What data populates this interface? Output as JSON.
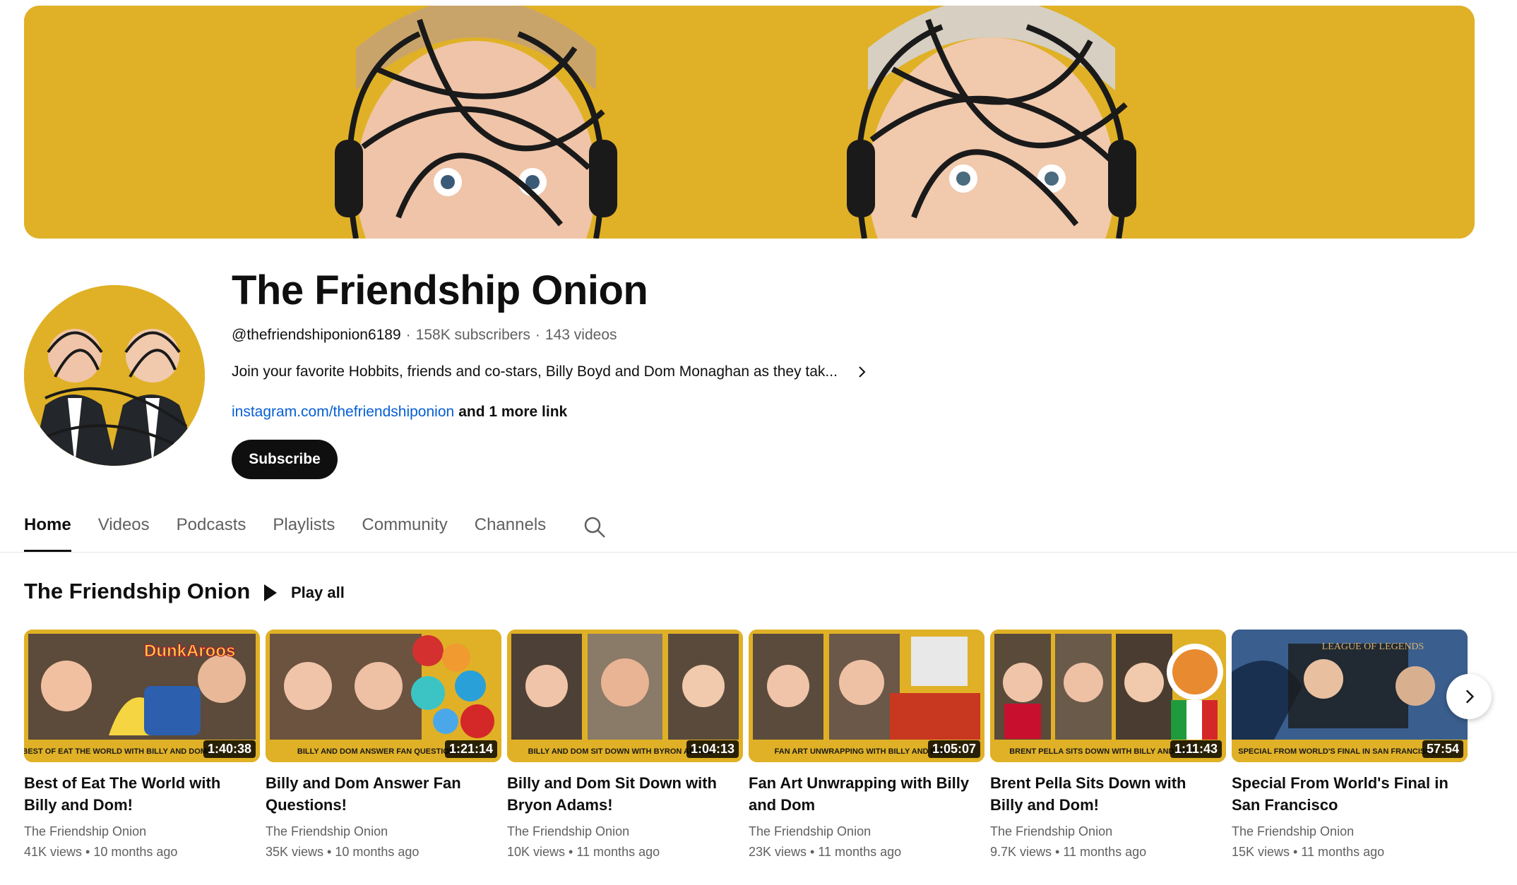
{
  "channel": {
    "title": "The Friendship Onion",
    "handle": "@thefriendshiponion6189",
    "subscribers": "158K subscribers",
    "videos_count": "143 videos",
    "separator": "·",
    "description": "Join your favorite Hobbits, friends and co-stars, Billy Boyd and Dom Monaghan as they tak...",
    "link": "instagram.com/thefriendshiponion",
    "more_links": "and 1 more link",
    "subscribe_label": "Subscribe",
    "brand_color": "#e0b126"
  },
  "tabs": [
    {
      "label": "Home",
      "active": true
    },
    {
      "label": "Videos",
      "active": false
    },
    {
      "label": "Podcasts",
      "active": false
    },
    {
      "label": "Playlists",
      "active": false
    },
    {
      "label": "Community",
      "active": false
    },
    {
      "label": "Channels",
      "active": false
    }
  ],
  "shelf": {
    "title": "The Friendship Onion",
    "play_all_label": "Play all"
  },
  "videos": [
    {
      "title": "Best of Eat The World with Billy and Dom!",
      "channel": "The Friendship Onion",
      "views": "41K views",
      "age": "10 months ago",
      "duration": "1:40:38",
      "caption": "BEST OF EAT THE WORLD WITH BILLY AND DOM!",
      "brand_text": "DunkAroos"
    },
    {
      "title": "Billy and Dom Answer Fan Questions!",
      "channel": "The Friendship Onion",
      "views": "35K views",
      "age": "10 months ago",
      "duration": "1:21:14",
      "caption": "BILLY AND DOM ANSWER FAN QUESTIONS"
    },
    {
      "title": "Billy and Dom Sit Down with Bryon Adams!",
      "channel": "The Friendship Onion",
      "views": "10K views",
      "age": "11 months ago",
      "duration": "1:04:13",
      "caption": "BILLY AND DOM SIT DOWN WITH BYRON ADAMS"
    },
    {
      "title": "Fan Art Unwrapping with Billy and Dom",
      "channel": "The Friendship Onion",
      "views": "23K views",
      "age": "11 months ago",
      "duration": "1:05:07",
      "caption": "FAN ART UNWRAPPING WITH BILLY AND DOM"
    },
    {
      "title": "Brent Pella Sits Down with Billy and Dom!",
      "channel": "The Friendship Onion",
      "views": "9.7K views",
      "age": "11 months ago",
      "duration": "1:11:43",
      "caption": "BRENT PELLA SITS DOWN WITH BILLY AND DOM!"
    },
    {
      "title": "Special From World's Final in San Francisco",
      "channel": "The Friendship Onion",
      "views": "15K views",
      "age": "11 months ago",
      "duration": "57:54",
      "caption": "SPECIAL FROM WORLD'S FINAL IN SAN FRANCISCO",
      "brand_text": "LEAGUE OF LEGENDS"
    }
  ],
  "icons": {
    "description_expand": "chevron-right-icon",
    "search": "search-icon",
    "play_all": "play-icon",
    "next": "chevron-right-icon"
  }
}
